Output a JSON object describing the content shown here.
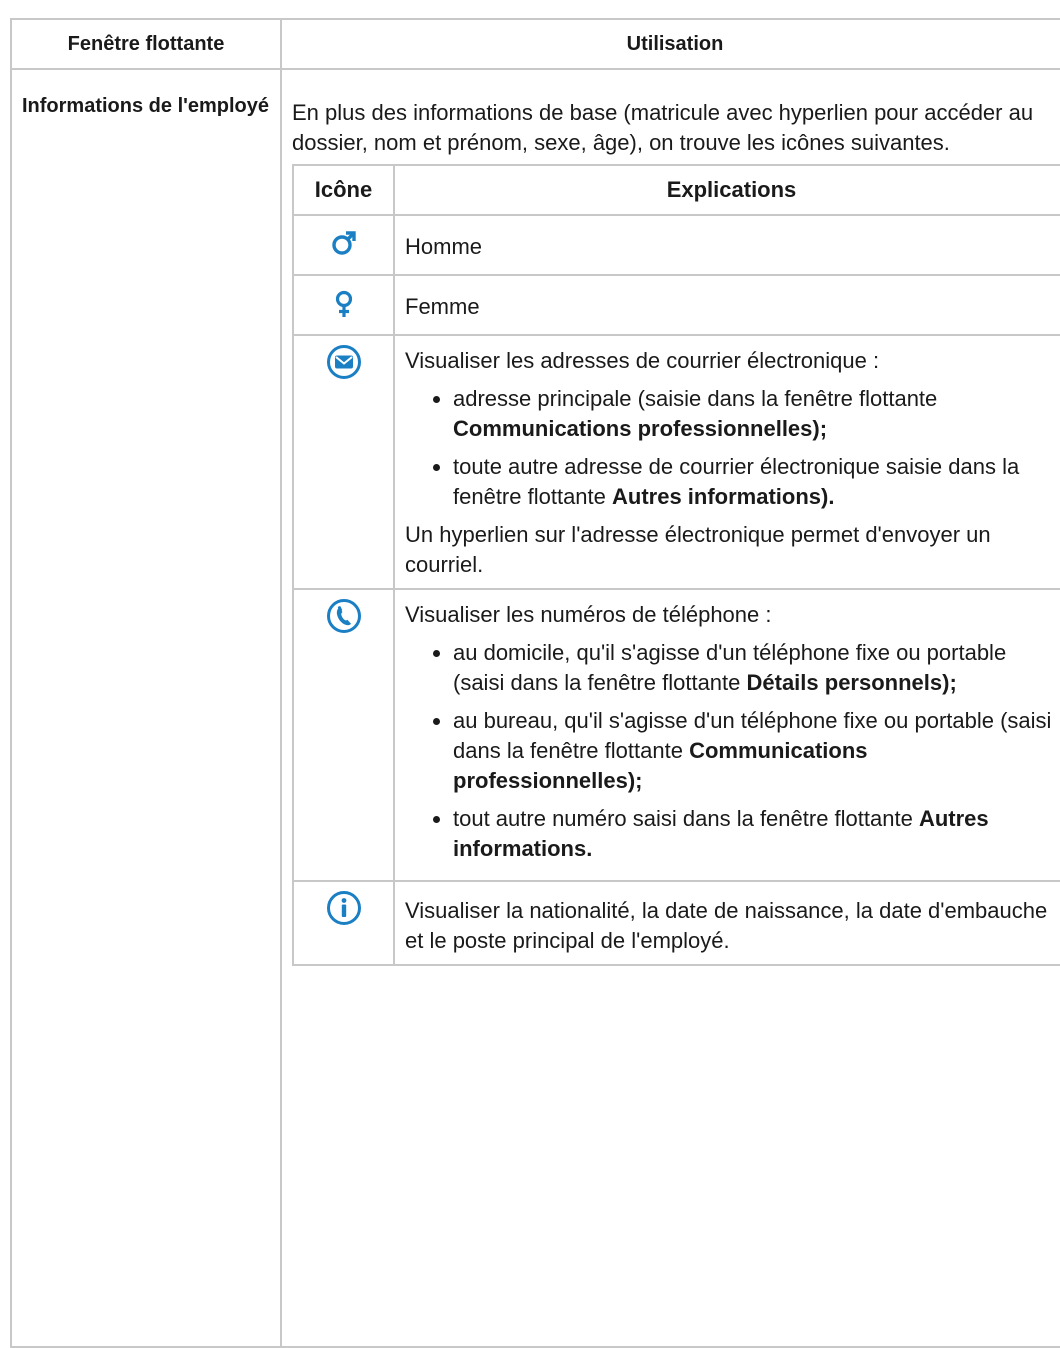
{
  "header": {
    "col1": "Fenêtre flottante",
    "col2": "Utilisation"
  },
  "row": {
    "label": "Informations de l'employé",
    "intro": "En plus des informations de base (matricule avec hyperlien pour accéder au dossier, nom et prénom, sexe, âge), on trouve les icônes suivantes."
  },
  "inner_table": {
    "header_icon": "Icône",
    "header_explanations": "Explications",
    "rows": [
      {
        "icon": "male-icon",
        "text": "Homme"
      },
      {
        "icon": "female-icon",
        "text": "Femme"
      },
      {
        "icon": "email-icon",
        "intro": "Visualiser les adresses de courrier électronique :",
        "bullets": [
          {
            "text": "adresse principale (saisie dans la fenêtre flottante ",
            "bold": "Communications professionnelles);"
          },
          {
            "text": "toute autre adresse de courrier électronique saisie dans la fenêtre flottante ",
            "bold": "Autres informations)."
          }
        ],
        "outro": "Un hyperlien sur l'adresse électronique permet d'envoyer un courriel."
      },
      {
        "icon": "phone-icon",
        "intro": "Visualiser les numéros de téléphone :",
        "bullets": [
          {
            "text": "au domicile, qu'il s'agisse d'un téléphone fixe ou portable (saisi dans la fenêtre flottante ",
            "bold": "Détails personnels);"
          },
          {
            "text": "au bureau, qu'il s'agisse d'un téléphone fixe ou portable (saisi dans la fenêtre flottante ",
            "bold": "Communications professionnelles);"
          },
          {
            "text": "tout autre numéro saisi dans la fenêtre flottante ",
            "bold": "Autres informations."
          }
        ]
      },
      {
        "icon": "info-icon",
        "text": "Visualiser la nationalité, la date de naissance, la date d'embauche et le poste principal de l'employé."
      }
    ]
  },
  "colors": {
    "icon_blue": "#1b7fc4",
    "border": "#c8c8c8"
  }
}
